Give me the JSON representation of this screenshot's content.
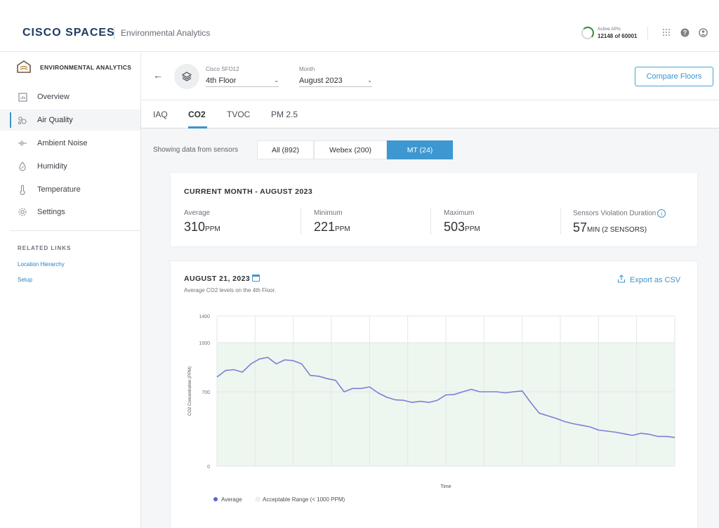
{
  "app": {
    "brand": "CISCO SPACES",
    "product": "Environmental Analytics",
    "active_apis_label": "Active APIs",
    "active_apis_value": "12148 of 60001"
  },
  "sidebar": {
    "header": "ENVIRONMENTAL ANALYTICS",
    "items": [
      {
        "label": "Overview",
        "icon": "overview-icon"
      },
      {
        "label": "Air Quality",
        "icon": "air-quality-icon",
        "active": true
      },
      {
        "label": "Ambient Noise",
        "icon": "ambient-noise-icon"
      },
      {
        "label": "Humidity",
        "icon": "humidity-icon"
      },
      {
        "label": "Temperature",
        "icon": "temperature-icon"
      },
      {
        "label": "Settings",
        "icon": "gear-icon"
      }
    ],
    "related_links_title": "RELATED LINKS",
    "related_links": [
      "Location Hierarchy",
      "Setup"
    ]
  },
  "header": {
    "building_label": "Cisco SFO12",
    "floor_value": "4th Floor",
    "month_label": "Month",
    "month_value": "August 2023",
    "compare_button": "Compare Floors"
  },
  "tabs": [
    "IAQ",
    "CO2",
    "TVOC",
    "PM 2.5"
  ],
  "active_tab": "CO2",
  "sensors": {
    "label": "Showing data from sensors",
    "options": [
      "All (892)",
      "Webex (200)",
      "MT (24)"
    ],
    "selected": "MT (24)"
  },
  "summary": {
    "title": "CURRENT MONTH - AUGUST 2023",
    "stats": [
      {
        "label": "Average",
        "value": "310",
        "unit": "PPM"
      },
      {
        "label": "Minimum",
        "value": "221",
        "unit": "PPM"
      },
      {
        "label": "Maximum",
        "value": "503",
        "unit": "PPM"
      },
      {
        "label": "Sensors Violation Duration",
        "value": "57",
        "unit": "MIN (2 SENSORS)"
      }
    ]
  },
  "daily": {
    "title": "AUGUST 21, 2023",
    "subtitle": "Average CO2 levels on the 4th Floor.",
    "export_label": "Export as CSV"
  },
  "colors": {
    "accent": "#3b95cd",
    "line": "#7b7fd6",
    "acceptable_band": "#eef6f0"
  },
  "chart_data": {
    "type": "line",
    "xlabel": "Time",
    "ylabel": "CO2 Concentration (PPM)",
    "yticks": [
      "1400",
      "1000",
      "700",
      "0"
    ],
    "ylim": [
      0,
      1400
    ],
    "acceptable_max": 1000,
    "legend": [
      "Average",
      "Acceptable Range (< 1000 PPM)"
    ],
    "legend_position": "bottom-left",
    "grid": true,
    "series": [
      {
        "name": "Average",
        "values": [
          790,
          830,
          835,
          820,
          870,
          900,
          910,
          870,
          895,
          890,
          870,
          800,
          795,
          780,
          770,
          700,
          720,
          720,
          730,
          690,
          650,
          625,
          620,
          600,
          610,
          600,
          620,
          670,
          675,
          700,
          715,
          700,
          700,
          700,
          690,
          700,
          705,
          600,
          500,
          475,
          450,
          420,
          400,
          385,
          370,
          340,
          330,
          320,
          305,
          290,
          310,
          300,
          280,
          280,
          270
        ]
      }
    ]
  }
}
